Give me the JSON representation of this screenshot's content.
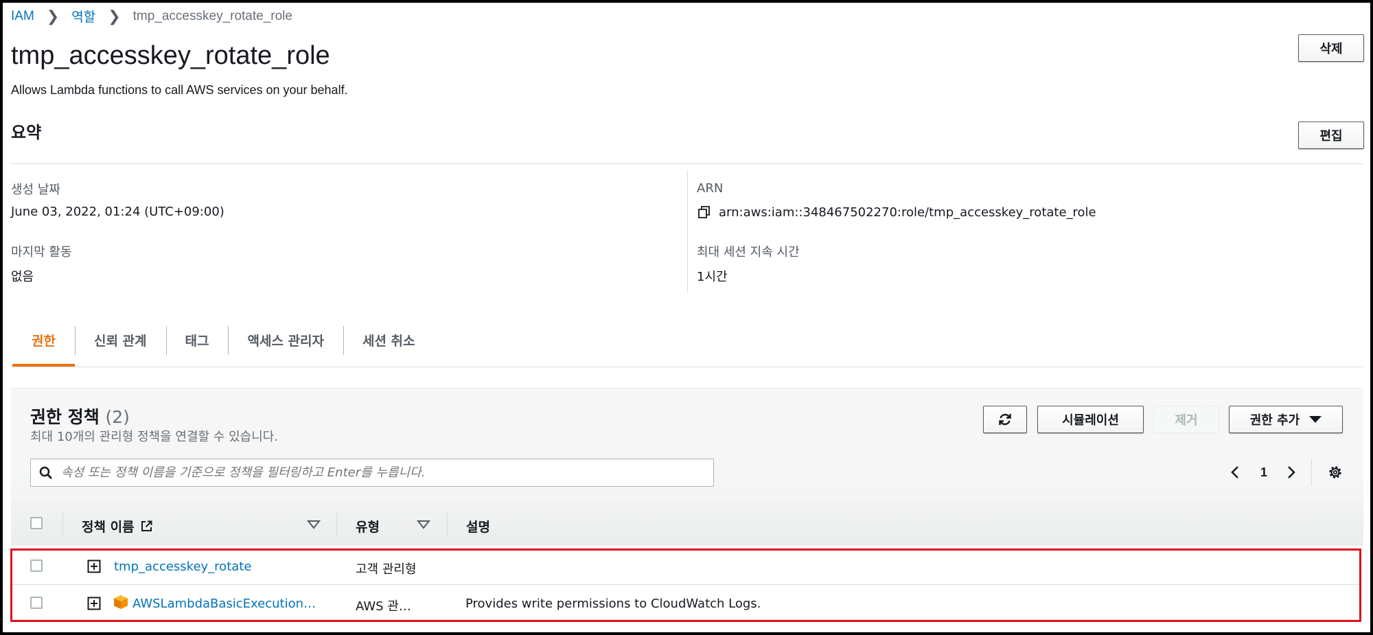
{
  "breadcrumb": {
    "items": [
      "IAM",
      "역할"
    ],
    "current": "tmp_accesskey_rotate_role"
  },
  "header": {
    "title": "tmp_accesskey_rotate_role",
    "description": "Allows Lambda functions to call AWS services on your behalf.",
    "delete_label": "삭제"
  },
  "summary": {
    "heading": "요약",
    "edit_label": "편집",
    "created_label": "생성 날짜",
    "created_value": "June 03, 2022, 01:24 (UTC+09:00)",
    "last_activity_label": "마지막 활동",
    "last_activity_value": "없음",
    "arn_label": "ARN",
    "arn_value": "arn:aws:iam::348467502270:role/tmp_accesskey_rotate_role",
    "max_session_label": "최대 세션 지속 시간",
    "max_session_value": "1시간"
  },
  "tabs": [
    {
      "label": "권한",
      "active": true
    },
    {
      "label": "신뢰 관계",
      "active": false
    },
    {
      "label": "태그",
      "active": false
    },
    {
      "label": "액세스 관리자",
      "active": false
    },
    {
      "label": "세션 취소",
      "active": false
    }
  ],
  "policies": {
    "heading": "권한 정책",
    "count": "(2)",
    "description": "최대 10개의 관리형 정책을 연결할 수 있습니다.",
    "simulate_label": "시뮬레이션",
    "remove_label": "제거",
    "add_label": "권한 추가",
    "search_placeholder": "속성 또는 정책 이름을 기준으로 정책을 필터링하고 Enter를 누릅니다.",
    "page": "1",
    "columns": [
      "정책 이름",
      "유형",
      "설명"
    ],
    "rows": [
      {
        "name": "tmp_accesskey_rotate",
        "type": "고객 관리형",
        "description": "",
        "aws_managed": false
      },
      {
        "name": "AWSLambdaBasicExecution…",
        "type": "AWS 관…",
        "description": "Provides write permissions to CloudWatch Logs.",
        "aws_managed": true
      }
    ]
  },
  "colors": {
    "link": "#0073bb",
    "accent": "#ec7211",
    "highlight": "#e0101e",
    "aws_box": "#f29100"
  }
}
